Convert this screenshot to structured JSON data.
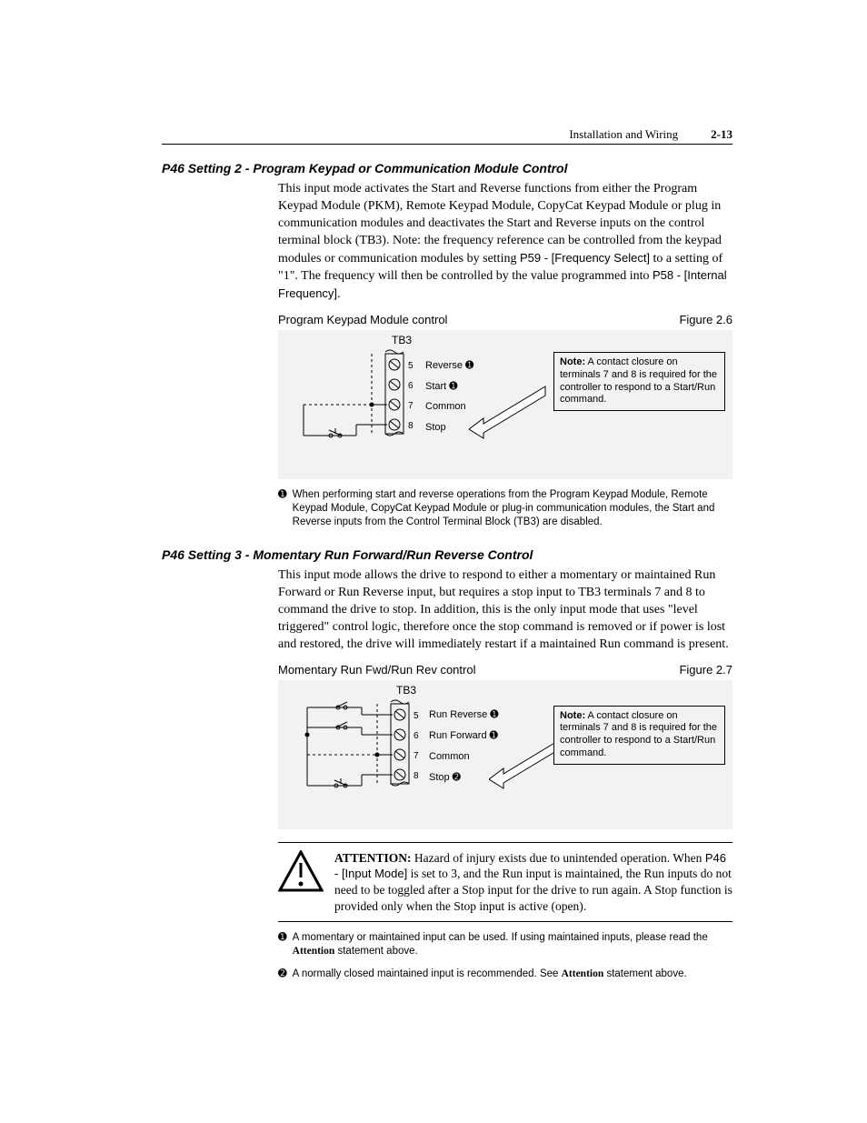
{
  "header": {
    "title": "Installation and Wiring",
    "page": "2-13"
  },
  "sec1": {
    "heading": "P46 Setting 2 - Program Keypad or Communication Module Control",
    "para_a": "This input mode activates the Start and Reverse functions from either the Program Keypad Module (PKM), Remote Keypad Module, CopyCat Keypad Module or plug in communication modules and deactivates the Start and Reverse inputs on the control terminal block (TB3). Note: the frequency reference can be controlled from the keypad modules or communication modules by setting ",
    "para_b": "P59 - [Frequency Select]",
    "para_c": " to a setting of \"1\". The frequency will then be controlled by the value programmed into ",
    "para_d": "P58 - [Internal Frequency]",
    "para_e": ".",
    "fig_caption": "Program Keypad Module control",
    "fig_label": "Figure 2.6",
    "tb_label": "TB3",
    "terms": {
      "t5": "Reverse ➊",
      "t6": "Start ➊",
      "t7": "Common",
      "t8": "Stop"
    },
    "note_bold": "Note:",
    "note_text": " A contact closure on terminals 7 and 8 is required for the controller to respond to a Start/Run command.",
    "footnote1": "When performing start and reverse operations from the Program Keypad Module, Remote Keypad Module, CopyCat Keypad Module or plug-in communication modules, the Start and Reverse inputs from the Control Terminal Block (TB3) are disabled."
  },
  "sec2": {
    "heading": "P46 Setting 3 - Momentary Run Forward/Run Reverse Control",
    "para": "This input mode allows the drive to respond to either a momentary or maintained Run Forward or Run Reverse input, but requires a stop input to TB3 terminals 7 and 8 to command the drive to stop. In addition, this is the only input mode that uses \"level triggered\" control logic, therefore once the stop command is removed or if power is lost and restored, the drive will immediately restart if a maintained Run command is present.",
    "fig_caption": "Momentary Run Fwd/Run Rev control",
    "fig_label": "Figure 2.7",
    "tb_label": "TB3",
    "terms": {
      "t5": "Run Reverse ➊",
      "t6": "Run Forward ➊",
      "t7": "Common",
      "t8": "Stop ➋"
    },
    "note_bold": "Note:",
    "note_text": " A contact closure on terminals 7 and 8 is required for the controller to respond to a Start/Run command.",
    "attn_bold": "ATTENTION:",
    "attn_a": "  Hazard of injury exists due to unintended operation. When ",
    "attn_b": "P46 - [Input Mode]",
    "attn_c": " is set to 3, and the Run input is maintained, the Run inputs do not need to be toggled after a Stop input for the drive to run again. A Stop function is provided only when the Stop input is active (open).",
    "foot1_a": "A momentary or maintained input can be used. If using maintained inputs, please read the ",
    "foot1_b": "Attention",
    "foot1_c": " statement above.",
    "foot2_a": "A normally closed maintained input is recommended. See ",
    "foot2_b": "Attention",
    "foot2_c": " statement above."
  }
}
